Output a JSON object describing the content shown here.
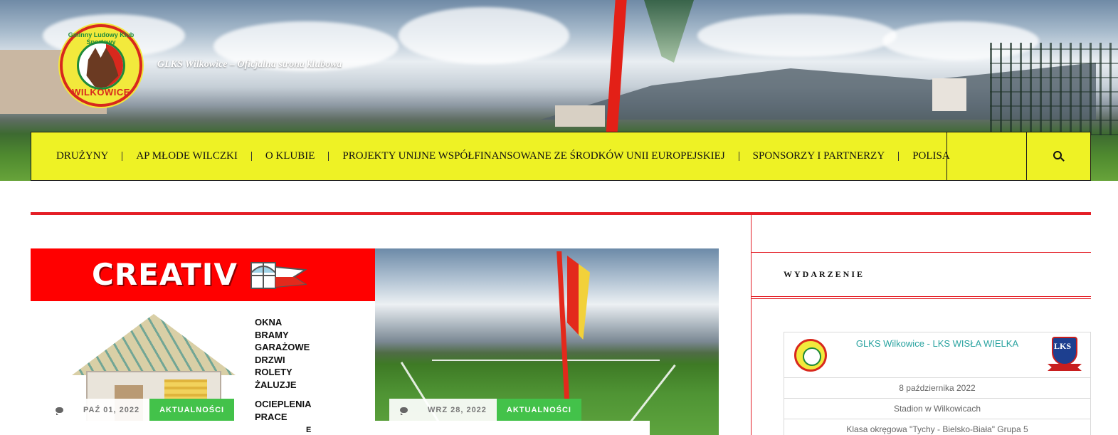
{
  "site": {
    "tagline": "GLKS Wilkowice – Oficjalna strona klubowa",
    "logo_text_arc": "Gminny Ludowy Klub Sportowy",
    "logo_text_bottom": "WILKOWICE"
  },
  "nav": {
    "items": [
      {
        "label": "DRUŻYNY"
      },
      {
        "label": "AP MŁODE WILCZKI"
      },
      {
        "label": "O KLUBIE"
      },
      {
        "label": "PROJEKTY UNIJNE WSPÓŁFINANSOWANE ZE ŚRODKÓW UNII EUROPEJSKIEJ"
      },
      {
        "label": "SPONSORZY I PARTNERZY"
      },
      {
        "label": "POLISA"
      }
    ],
    "search_icon": "search-icon"
  },
  "colors": {
    "nav_bg": "#eef225",
    "accent_red": "#e41e26",
    "category_green": "#43c24a",
    "event_link": "#2aa3a0"
  },
  "posts": [
    {
      "ad_title": "CREATIV",
      "offer_lines": [
        "OKNA",
        "BRAMY",
        "GARAŻOWE",
        "DRZWI",
        "ROLETY",
        "ŻALUZJE"
      ],
      "offer_lines_2": [
        "OCIEPLENIA",
        "PRACE"
      ],
      "comment_icon": "comment-icon",
      "date": "PAŹ 01, 2022",
      "category": "AKTUALNOŚCI"
    },
    {
      "comment_icon": "comment-icon",
      "date": "WRZ 28, 2022",
      "category": "AKTUALNOŚCI"
    }
  ],
  "under_text": "E",
  "sidebar": {
    "widget_title": "WYDARZENIE",
    "event": {
      "title": "GLKS Wilkowice - LKS WISŁA WIELKA",
      "date": "8 października 2022",
      "venue": "Stadion w Wilkowicach",
      "league": "Klasa okręgowa \"Tychy - Bielsko-Biała\" Grupa 5",
      "away_logo_text": "LKS"
    }
  }
}
